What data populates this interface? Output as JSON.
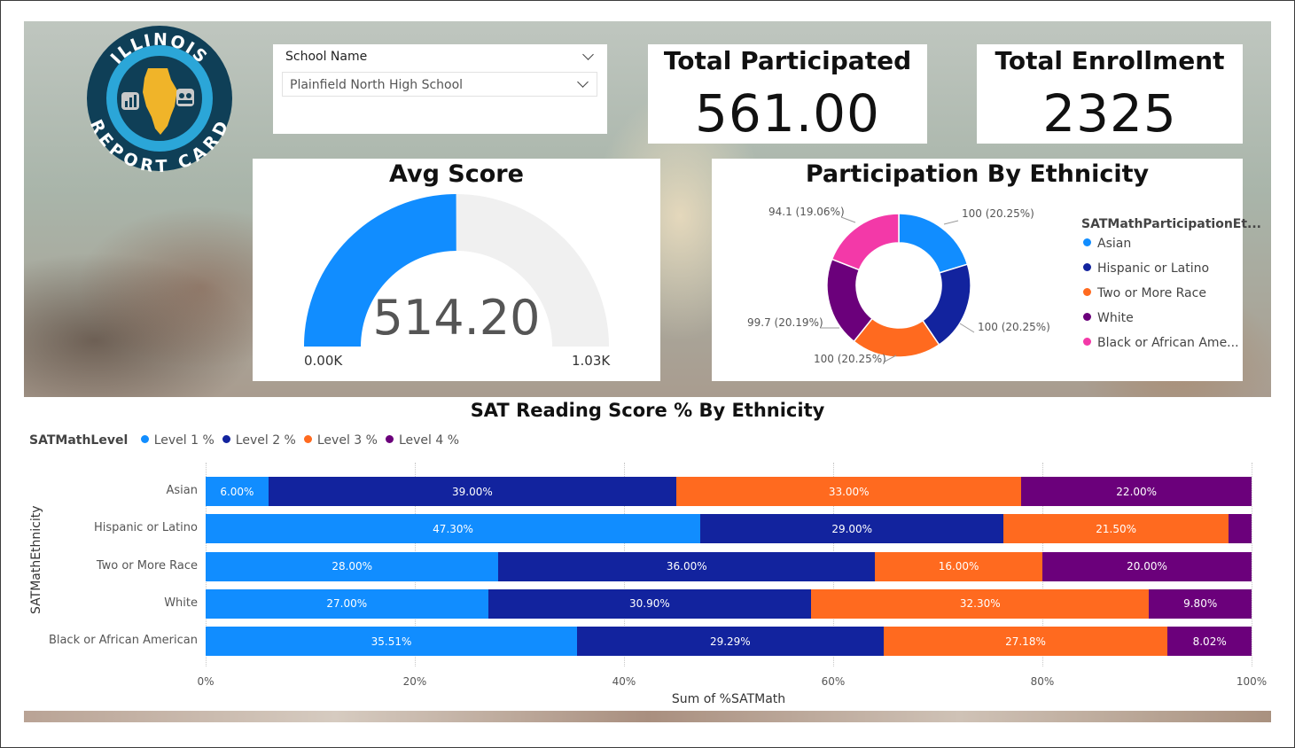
{
  "logo": {
    "top_text": "ILLINOIS",
    "bottom_text": "REPORT CARD"
  },
  "slicer": {
    "label": "School Name",
    "value": "Plainfield North High School"
  },
  "kpis": [
    {
      "title": "Total Participated",
      "value": "561.00"
    },
    {
      "title": "Total Enrollment",
      "value": "2325"
    }
  ],
  "gauge": {
    "title": "Avg Score",
    "value": 514.2,
    "value_label": "514.20",
    "min": 0,
    "max": 1030,
    "min_label": "0.00K",
    "max_label": "1.03K",
    "fill_color": "#118DFF",
    "track_color": "#F0F0F0"
  },
  "donut": {
    "title": "Participation By Ethnicity",
    "legend_title": "SATMathParticipationEt...",
    "slices": [
      {
        "name": "Asian",
        "legend_label": "Asian",
        "value": 100,
        "pct": 20.25,
        "label": "100 (20.25%)",
        "color": "#118DFF"
      },
      {
        "name": "Hispanic or Latino",
        "legend_label": "Hispanic or Latino",
        "value": 100,
        "pct": 20.25,
        "label": "100 (20.25%)",
        "color": "#12239E"
      },
      {
        "name": "Two or More Race",
        "legend_label": "Two or More Race",
        "value": 100,
        "pct": 20.25,
        "label": "100 (20.25%)",
        "color": "#FF6A1F"
      },
      {
        "name": "White",
        "legend_label": "White",
        "value": 99.7,
        "pct": 20.19,
        "label": "99.7 (20.19%)",
        "color": "#6B007B"
      },
      {
        "name": "Black or African American",
        "legend_label": "Black or African Ame...",
        "value": 94.1,
        "pct": 19.06,
        "label": "94.1 (19.06%)",
        "color": "#F339A8"
      }
    ]
  },
  "chart_data": {
    "type": "bar",
    "orientation": "horizontal",
    "stacked": "100%",
    "title": "SAT Reading Score % By Ethnicity",
    "legend_title": "SATMathLevel",
    "legend_placement": "top-left",
    "xlabel": "Sum of %SATMath",
    "ylabel": "SATMathEthnicity",
    "xlim": [
      0,
      100
    ],
    "xticks": [
      "0%",
      "20%",
      "40%",
      "60%",
      "80%",
      "100%"
    ],
    "categories": [
      "Asian",
      "Hispanic or Latino",
      "Two or More Race",
      "White",
      "Black or African American"
    ],
    "series": [
      {
        "name": "Level 1 %",
        "color": "#118DFF",
        "values": [
          6.0,
          47.3,
          28.0,
          27.0,
          35.51
        ],
        "labels": [
          "6.00%",
          "47.30%",
          "28.00%",
          "27.00%",
          "35.51%"
        ]
      },
      {
        "name": "Level 2 %",
        "color": "#12239E",
        "values": [
          39.0,
          29.0,
          36.0,
          30.9,
          29.29
        ],
        "labels": [
          "39.00%",
          "29.00%",
          "36.00%",
          "30.90%",
          "29.29%"
        ]
      },
      {
        "name": "Level 3 %",
        "color": "#FF6A1F",
        "values": [
          33.0,
          21.5,
          16.0,
          32.3,
          27.18
        ],
        "labels": [
          "33.00%",
          "21.50%",
          "16.00%",
          "32.30%",
          "27.18%"
        ]
      },
      {
        "name": "Level 4 %",
        "color": "#6B007B",
        "values": [
          22.0,
          2.2,
          20.0,
          9.8,
          8.02
        ],
        "labels": [
          "22.00%",
          "",
          "20.00%",
          "9.80%",
          "8.02%"
        ]
      }
    ]
  }
}
